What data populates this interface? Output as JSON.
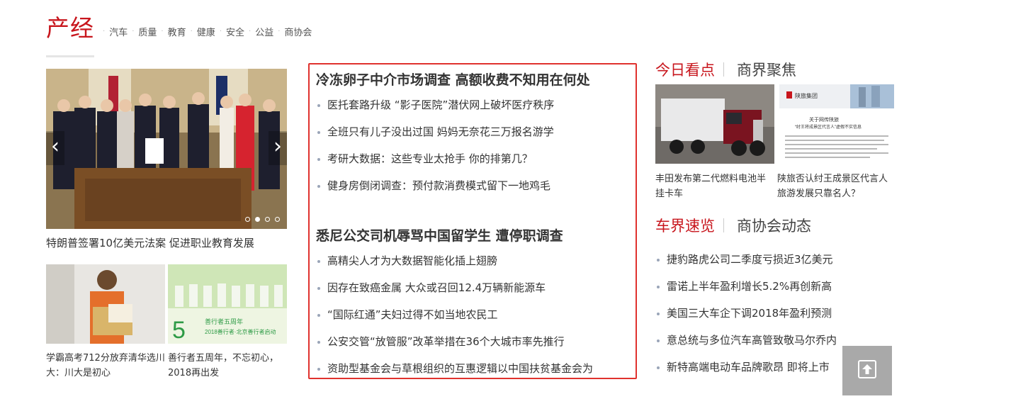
{
  "section": {
    "title": "产经",
    "nav": [
      "汽车",
      "质量",
      "教育",
      "健康",
      "安全",
      "公益",
      "商协会"
    ]
  },
  "slider": {
    "caption": "特朗普签署10亿美元法案 促进职业教育发展",
    "prev": "‹",
    "next": "›",
    "dot_count": 4,
    "active_dot": 1
  },
  "thumbs": [
    {
      "caption": "学霸高考712分放弃清华选川大：川大是初心"
    },
    {
      "caption": "善行者五周年，不忘初心，2018再出发"
    }
  ],
  "middle": {
    "blocks": [
      {
        "headline": "冷冻卵子中介市场调查 高额收费不知用在何处",
        "items": [
          "医托套路升级 “影子医院”潜伏网上破坏医疗秩序",
          "全班只有儿子没出过国 妈妈无奈花三万报名游学",
          "考研大数据：这些专业太抢手 你的排第几？",
          "健身房倒闭调查：预付款消费模式留下一地鸡毛"
        ]
      },
      {
        "headline": "悉尼公交司机辱骂中国留学生 遭停职调查",
        "items": [
          "高精尖人才为大数据智能化插上翅膀",
          "因存在致癌金属 大众或召回12.4万辆新能源车",
          " “国际红通”夫妇过得不如当地农民工",
          "公安交管“放管服”改革举措在36个大城市率先推行",
          "资助型基金会与草根组织的互惠逻辑以中国扶贫基金会为"
        ]
      }
    ]
  },
  "right": {
    "tabs1": {
      "active": "今日看点",
      "inactive": "商界聚焦"
    },
    "cards": [
      {
        "caption": "丰田发布第二代燃料电池半挂卡车"
      },
      {
        "caption": "陕旅否认纣王成景区代言人 旅游发展只靠名人？"
      }
    ],
    "tabs2": {
      "active": "车界速览",
      "inactive": "商协会动态"
    },
    "list": [
      "捷豹路虎公司二季度亏损近3亿美元",
      "雷诺上半年盈利增长5.2%再创新高",
      "美国三大车企下调2018年盈利预测",
      "意总统与多位汽车高管致敬马尔乔内",
      "新特高端电动车品牌歌昂 即将上市"
    ]
  },
  "card_image": {
    "logo_text": "陕旅集团",
    "doc_title": "关于网传陕旅",
    "doc_subtitle": "“纣王将成景区代言人”虚假不实信息"
  },
  "thumb_image": {
    "banner_text": "善行者五周年",
    "banner_sub": "2018善行者·北京善行者启动"
  },
  "colors": {
    "accent": "#c8161d",
    "box_border": "#e0322e",
    "back_top_bg": "#a9a9a9"
  },
  "icons": {
    "back_to_top": "arrow-up-box-icon"
  }
}
